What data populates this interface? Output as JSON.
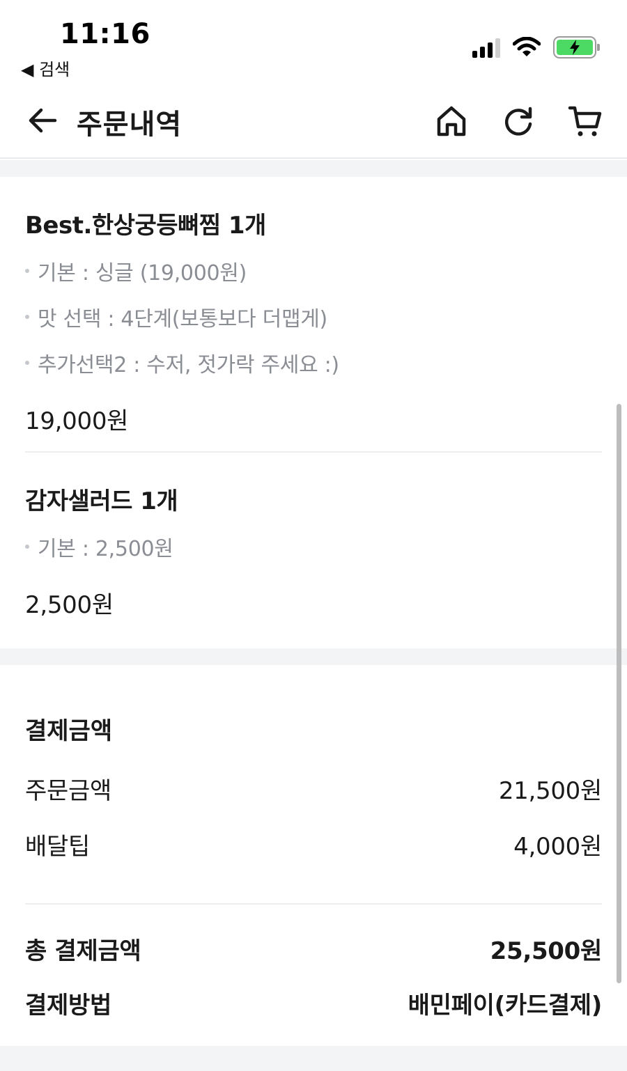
{
  "status_bar": {
    "time": "11:16",
    "back_label": "◀ 검색",
    "icons": [
      "cellular-signal-icon",
      "wifi-icon",
      "battery-charging-icon"
    ],
    "battery_level": 0.85,
    "battery_color": "#4cd964"
  },
  "header": {
    "title": "주문내역",
    "icons": [
      "back-arrow-icon",
      "home-icon",
      "refresh-icon",
      "cart-icon"
    ]
  },
  "order": {
    "items": [
      {
        "name": "Best.한상궁등뼈찜 1개",
        "options": [
          "기본 : 싱글 (19,000원)",
          "맛 선택 : 4단계(보통보다 더맵게)",
          "추가선택2 : 수저, 젓가락 주세요 :)"
        ],
        "price": "19,000원"
      },
      {
        "name": "감자샐러드 1개",
        "options": [
          "기본 : 2,500원"
        ],
        "price": "2,500원"
      }
    ]
  },
  "payment": {
    "title": "결제금액",
    "order_amount_label": "주문금액",
    "order_amount": "21,500원",
    "delivery_tip_label": "배달팁",
    "delivery_tip": "4,000원",
    "total_label": "총 결제금액",
    "total": "25,500원",
    "method_label": "결제방법",
    "method": "배민페이(카드결제)"
  },
  "colors": {
    "background": "#ffffff",
    "band": "#f3f4f6",
    "text_primary": "#1a1a1a",
    "text_secondary": "#8a8d93"
  }
}
